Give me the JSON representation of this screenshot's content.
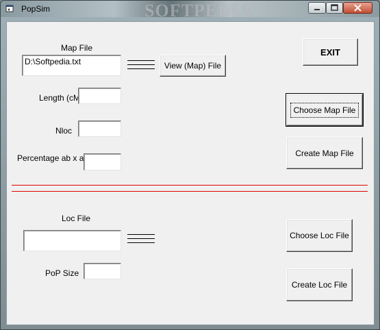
{
  "window": {
    "title": "PopSim",
    "watermark": "SOFTPEDIA",
    "controls": {
      "minimize": "minimize",
      "maximize": "maximize",
      "close": "close"
    }
  },
  "map_section": {
    "map_file_label": "Map File",
    "map_file_value": "D:\\Softpedia.txt",
    "view_button": "View (Map) File",
    "length_label": "Length (cM)",
    "length_value": "",
    "nloc_label": "Nloc",
    "nloc_value": "",
    "percentage_label": "Percentage ab x ab",
    "percentage_value": ""
  },
  "buttons": {
    "exit": "EXIT",
    "choose_map": "Choose Map File",
    "create_map": "Create Map File",
    "choose_loc": "Choose Loc File",
    "create_loc": "Create Loc File"
  },
  "loc_section": {
    "loc_file_label": "Loc File",
    "loc_file_value": "",
    "pop_size_label": "PoP Size",
    "pop_size_value": ""
  },
  "colors": {
    "separator": "#e00000",
    "face": "#f0f0f0"
  }
}
